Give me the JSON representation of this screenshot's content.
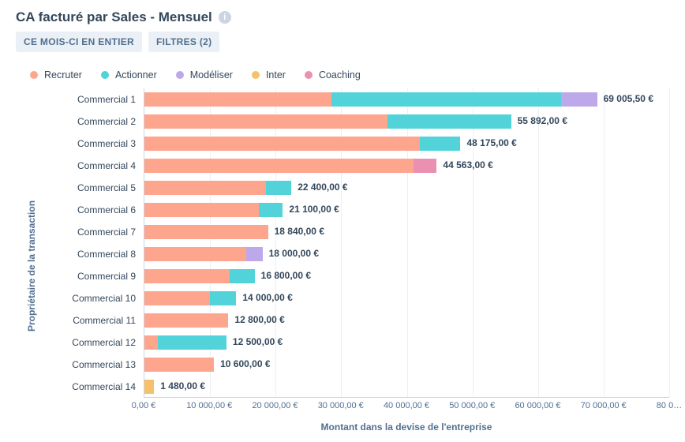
{
  "header": {
    "title": "CA facturé par Sales - Mensuel",
    "info_glyph": "i"
  },
  "chips": {
    "period": "CE MOIS-CI EN ENTIER",
    "filters": "FILTRES (2)"
  },
  "legend": [
    {
      "name": "Recruter",
      "color": "#fea58e"
    },
    {
      "name": "Actionner",
      "color": "#51d3d9"
    },
    {
      "name": "Modéliser",
      "color": "#bda9ea"
    },
    {
      "name": "Inter",
      "color": "#f5c26b"
    },
    {
      "name": "Coaching",
      "color": "#ea90b1"
    }
  ],
  "axis": {
    "ylabel": "Propriétaire de la transaction",
    "xlabel": "Montant dans la devise de l'entreprise",
    "xmax": 80000,
    "ticks": [
      {
        "v": 0,
        "label": "0,00 €"
      },
      {
        "v": 10000,
        "label": "10 000,00 €"
      },
      {
        "v": 20000,
        "label": "20 000,00 €"
      },
      {
        "v": 30000,
        "label": "30 000,00 €"
      },
      {
        "v": 40000,
        "label": "40 000,00 €"
      },
      {
        "v": 50000,
        "label": "50 000,00 €"
      },
      {
        "v": 60000,
        "label": "60 000,00 €"
      },
      {
        "v": 70000,
        "label": "70 000,00 €"
      },
      {
        "v": 80000,
        "label": "80 0…"
      }
    ]
  },
  "chart_data": {
    "type": "bar",
    "orientation": "horizontal",
    "stacked": true,
    "title": "CA facturé par Sales - Mensuel",
    "xlabel": "Montant dans la devise de l'entreprise",
    "ylabel": "Propriétaire de la transaction",
    "xlim": [
      0,
      80000
    ],
    "categories": [
      "Commercial 1",
      "Commercial 2",
      "Commercial 3",
      "Commercial 4",
      "Commercial 5",
      "Commercial 6",
      "Commercial 7",
      "Commercial 8",
      "Commercial 9",
      "Commercial 10",
      "Commercial 11",
      "Commercial 12",
      "Commercial 13",
      "Commercial 14"
    ],
    "series": [
      {
        "name": "Recruter",
        "color": "#fea58e",
        "values": [
          28500,
          37000,
          42000,
          41000,
          18500,
          17500,
          18840,
          15500,
          13000,
          10000,
          12800,
          2000,
          10600,
          0
        ]
      },
      {
        "name": "Actionner",
        "color": "#51d3d9",
        "values": [
          35000,
          18892,
          6175,
          0,
          3900,
          3600,
          0,
          0,
          3800,
          4000,
          0,
          10500,
          0,
          0
        ]
      },
      {
        "name": "Modéliser",
        "color": "#bda9ea",
        "values": [
          5505.5,
          0,
          0,
          0,
          0,
          0,
          0,
          2500,
          0,
          0,
          0,
          0,
          0,
          0
        ]
      },
      {
        "name": "Inter",
        "color": "#f5c26b",
        "values": [
          0,
          0,
          0,
          0,
          0,
          0,
          0,
          0,
          0,
          0,
          0,
          0,
          0,
          1480
        ]
      },
      {
        "name": "Coaching",
        "color": "#ea90b1",
        "values": [
          0,
          0,
          0,
          3563,
          0,
          0,
          0,
          0,
          0,
          0,
          0,
          0,
          0,
          0
        ]
      }
    ],
    "totals_label": [
      "69 005,50 €",
      "55 892,00 €",
      "48 175,00 €",
      "44 563,00 €",
      "22 400,00 €",
      "21 100,00 €",
      "18 840,00 €",
      "18 000,00 €",
      "16 800,00 €",
      "14 000,00 €",
      "12 800,00 €",
      "12 500,00 €",
      "10 600,00 €",
      "1 480,00 €"
    ]
  }
}
